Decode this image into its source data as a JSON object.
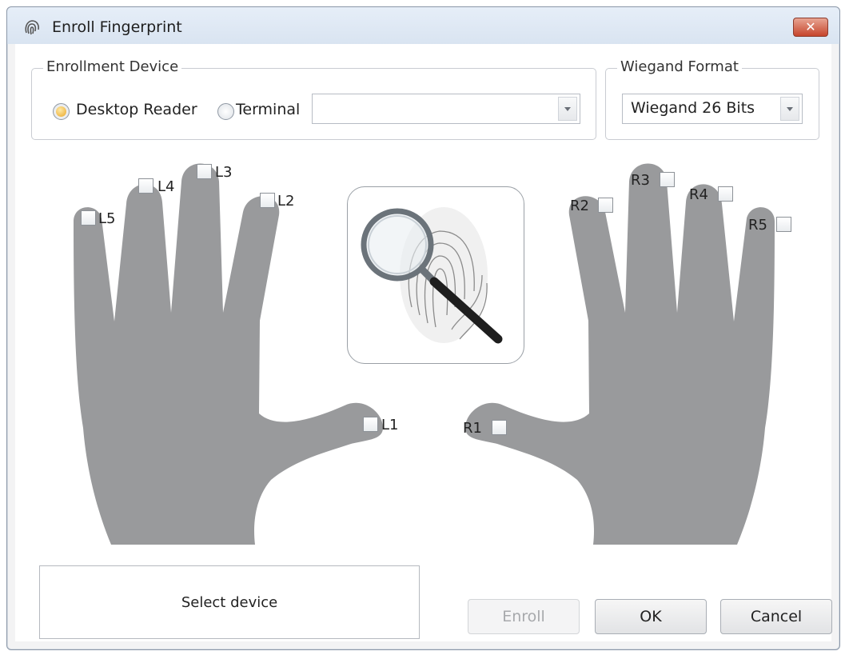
{
  "window": {
    "title": "Enroll Fingerprint",
    "close_label": "✕"
  },
  "enrollment_device": {
    "legend": "Enrollment Device",
    "desktop_reader_label": "Desktop Reader",
    "terminal_label": "Terminal",
    "terminal_value": "",
    "selected": "Desktop Reader"
  },
  "wiegand": {
    "legend": "Wiegand Format",
    "value": "Wiegand 26 Bits"
  },
  "fingers": {
    "left": [
      "L1",
      "L2",
      "L3",
      "L4",
      "L5"
    ],
    "right": [
      "R1",
      "R2",
      "R3",
      "R4",
      "R5"
    ],
    "checked": []
  },
  "status": {
    "text": "Select device"
  },
  "buttons": {
    "enroll": "Enroll",
    "ok": "OK",
    "cancel": "Cancel"
  },
  "icons": {
    "app": "fingerprint-icon",
    "scanner": "magnifier-fingerprint-icon"
  }
}
